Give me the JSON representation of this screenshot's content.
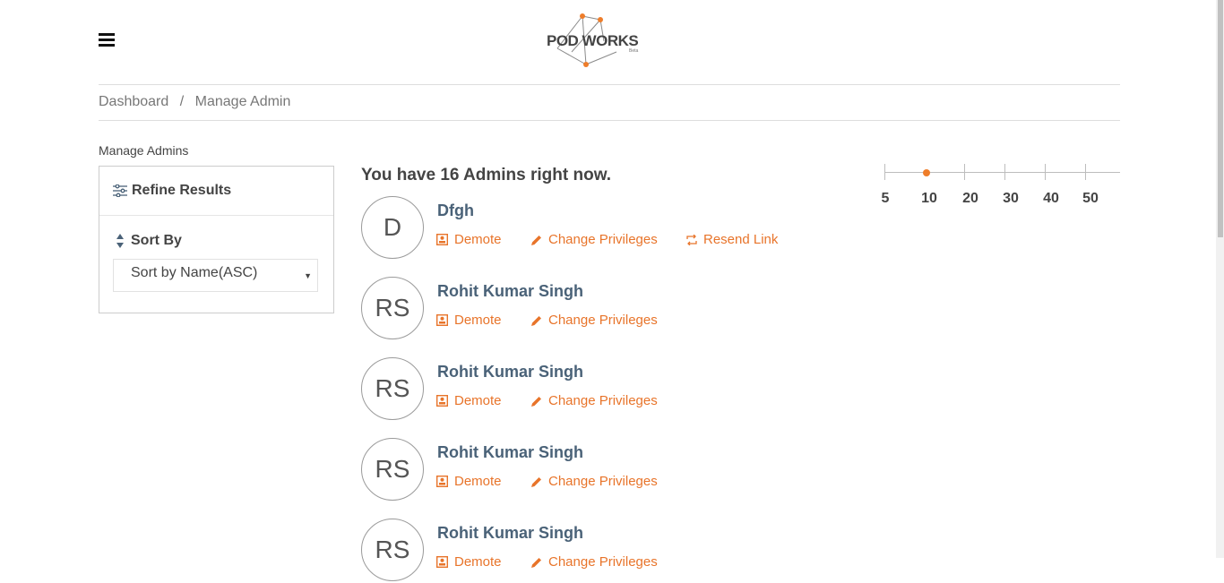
{
  "header": {
    "menu_icon": "hamburger-menu-icon",
    "logo_text": "POD WORKS",
    "logo_sub": "Beta",
    "accent": "#e8742a"
  },
  "breadcrumb": {
    "items": [
      "Dashboard",
      "Manage Admin"
    ],
    "separator": "/"
  },
  "sidebar": {
    "title": "Manage Admins",
    "refine_label": "Refine Results",
    "refine_icon": "sliders-icon",
    "sort_label": "Sort By",
    "sort_icon": "sort-icon",
    "sort_value": "Sort by Name(ASC)"
  },
  "main": {
    "count_title": "You have 16 Admins right now.",
    "admins": [
      {
        "initials": "D",
        "name": "Dfgh",
        "actions": {
          "demote": "Demote",
          "privileges": "Change Privileges",
          "resend": "Resend Link"
        }
      },
      {
        "initials": "RS",
        "name": "Rohit Kumar Singh",
        "actions": {
          "demote": "Demote",
          "privileges": "Change Privileges"
        }
      },
      {
        "initials": "RS",
        "name": "Rohit Kumar Singh",
        "actions": {
          "demote": "Demote",
          "privileges": "Change Privileges"
        }
      },
      {
        "initials": "RS",
        "name": "Rohit Kumar Singh",
        "actions": {
          "demote": "Demote",
          "privileges": "Change Privileges"
        }
      },
      {
        "initials": "RS",
        "name": "Rohit Kumar Singh",
        "actions": {
          "demote": "Demote",
          "privileges": "Change Privileges"
        }
      }
    ]
  },
  "page_size": {
    "options": [
      "5",
      "10",
      "20",
      "30",
      "40",
      "50"
    ],
    "selected": "10"
  }
}
